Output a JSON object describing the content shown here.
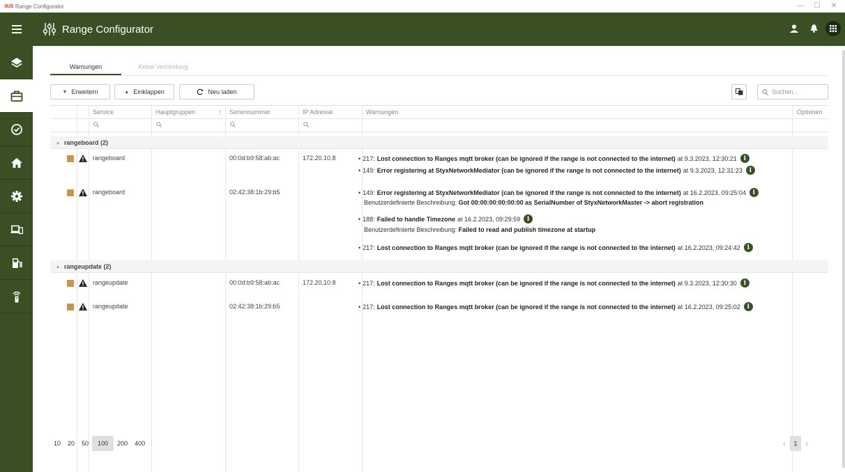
{
  "os": {
    "logo": "SUS",
    "title": "Range Configurator",
    "controls": [
      "—",
      "☐",
      "✕"
    ]
  },
  "header": {
    "title": "Range Configurator"
  },
  "sidebar": {
    "items": [
      {
        "icon": "layers-icon"
      },
      {
        "icon": "briefcase-icon"
      },
      {
        "icon": "check-circle-icon"
      },
      {
        "icon": "home-icon"
      },
      {
        "icon": "gear-icon"
      },
      {
        "icon": "devices-icon"
      },
      {
        "icon": "fuel-icon"
      },
      {
        "icon": "remote-icon"
      }
    ]
  },
  "tabs": [
    {
      "label": "Warnungen"
    },
    {
      "label": "Keine Verbindung"
    }
  ],
  "toolbar": {
    "expand": "Erweitern",
    "collapse": "Einklappen",
    "reload": "Neu laden",
    "search_placeholder": "Suchen..."
  },
  "columns": {
    "service": "Service",
    "hauptgruppen": "Hauptgruppen",
    "sort_indicator": "↑",
    "seriennummer": "Seriennummer",
    "ip": "IP Adresse",
    "warnungen": "Warnungen",
    "optionen": "Optionen"
  },
  "groups": [
    {
      "label": "rangeboard (2)",
      "rows": [
        {
          "service": "rangeboard",
          "serial": "00:0d:b9:58:ab:ac",
          "ip": "172.20.10.8",
          "warnings": [
            {
              "prefix": "217:",
              "bold": "Lost connection to Ranges mqtt broker (can be ignored if the range is not connected to the internet)",
              "suffix": "at 9.3.2023, 12:30:21"
            },
            {
              "prefix": "149:",
              "bold": "Error registering at StyxNetworkMediator (can be ignored if the range is not connected to the internet)",
              "suffix": "at 9.3.2023, 12:31:23"
            }
          ]
        },
        {
          "service": "rangeboard",
          "serial": "02:42:38:1b:29:b5",
          "ip": "",
          "warnings": [
            {
              "prefix": "149:",
              "bold": "Error registering at StyxNetworkMediator (can be ignored if the range is not connected to the internet)",
              "suffix": "at 16.2.2023, 09:25:04",
              "desc_label": "Benutzerdefinierte Beschreibung:",
              "desc": "Got 00:00:00:00:00:00 as SerialNumber of StyxNetworkMaster -> abort registration"
            },
            {
              "prefix": "188:",
              "bold": "Failed to handle Timezone",
              "suffix": "at 16.2.2023, 09:29:59",
              "desc_label": "Benutzerdefinierte Beschreibung:",
              "desc": "Failed to read and publish timezone at startup"
            },
            {
              "prefix": "217:",
              "bold": "Lost connection to Ranges mqtt broker (can be ignored if the range is not connected to the internet)",
              "suffix": "at 16.2.2023, 09:24:42"
            }
          ]
        }
      ]
    },
    {
      "label": "rangeupdate (2)",
      "rows": [
        {
          "service": "rangeupdate",
          "serial": "00:0d:b9:58:ab:ac",
          "ip": "172.20.10.8",
          "warnings": [
            {
              "prefix": "217:",
              "bold": "Lost connection to Ranges mqtt broker (can be ignored if the range is not connected to the internet)",
              "suffix": "at 9.3.2023, 12:30:30"
            }
          ]
        },
        {
          "service": "rangeupdate",
          "serial": "02:42:38:1b:29:b5",
          "ip": "",
          "warnings": [
            {
              "prefix": "217:",
              "bold": "Lost connection to Ranges mqtt broker (can be ignored if the range is not connected to the internet)",
              "suffix": "at 16.2.2023, 09:25:02"
            }
          ]
        }
      ]
    }
  ],
  "pager": {
    "sizes": [
      "10",
      "20",
      "50",
      "100",
      "200",
      "400"
    ],
    "active_size": "100",
    "page": "1"
  },
  "colors": {
    "primary": "#3b4f25",
    "status": "#c8964b"
  }
}
